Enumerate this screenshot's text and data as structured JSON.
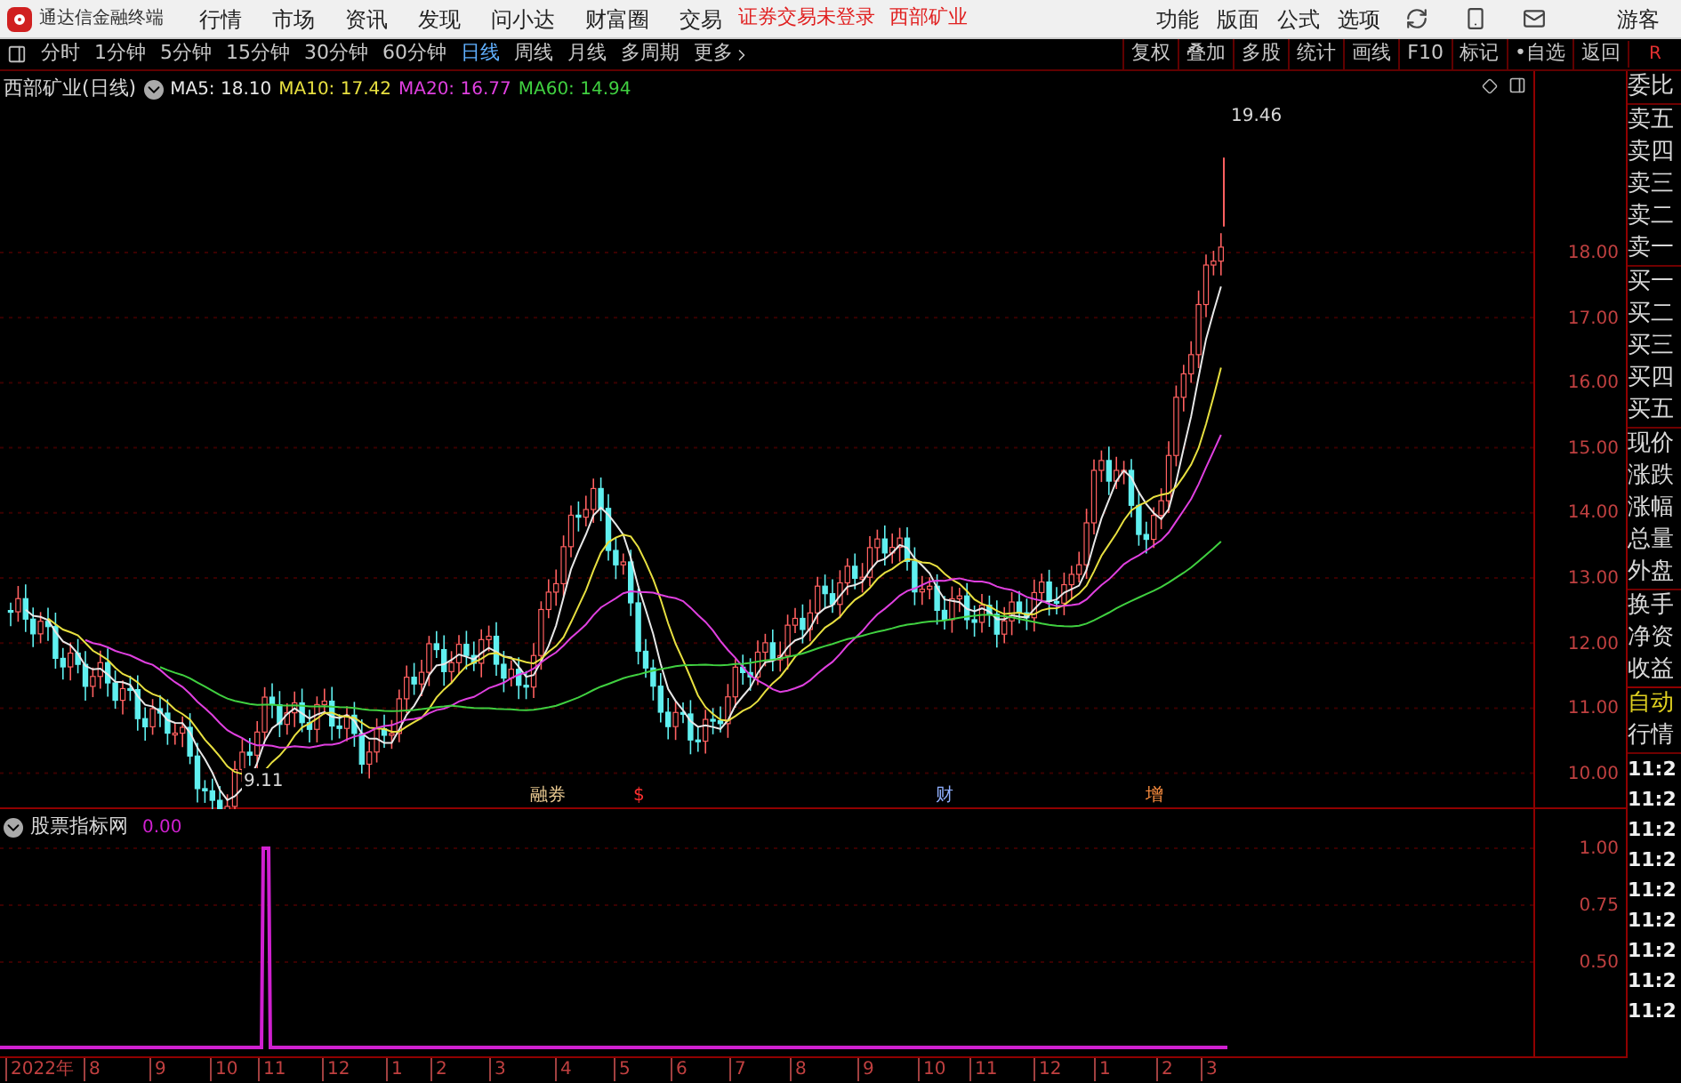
{
  "menubar": {
    "app_title": "通达信金融终端",
    "menus": [
      "行情",
      "市场",
      "资讯",
      "发现",
      "问小达",
      "财富圈",
      "交易"
    ],
    "status": "证券交易未登录",
    "stock": "西部矿业",
    "right_menus": [
      "功能",
      "版面",
      "公式",
      "选项"
    ],
    "user": "游客"
  },
  "toolbar": {
    "periods": [
      {
        "label": "分时",
        "selected": false
      },
      {
        "label": "1分钟",
        "selected": false
      },
      {
        "label": "5分钟",
        "selected": false
      },
      {
        "label": "15分钟",
        "selected": false
      },
      {
        "label": "30分钟",
        "selected": false
      },
      {
        "label": "60分钟",
        "selected": false
      },
      {
        "label": "日线",
        "selected": true
      },
      {
        "label": "周线",
        "selected": false
      },
      {
        "label": "月线",
        "selected": false
      },
      {
        "label": "多周期",
        "selected": false
      }
    ],
    "more": "更多",
    "actions": [
      "复权",
      "叠加",
      "多股",
      "统计",
      "画线",
      "F10",
      "标记",
      "•自选",
      "返回"
    ]
  },
  "chart": {
    "title": "西部矿业(日线)",
    "ma": [
      {
        "label": "MA5: 18.10",
        "color": "#e8e8e8"
      },
      {
        "label": "MA10: 17.42",
        "color": "#e8e040"
      },
      {
        "label": "MA20: 16.77",
        "color": "#e040e0"
      },
      {
        "label": "MA60: 14.94",
        "color": "#40d040"
      }
    ],
    "price_ticks": [
      "18.00",
      "17.00",
      "16.00",
      "15.00",
      "14.00",
      "13.00",
      "12.00",
      "11.00",
      "10.00"
    ],
    "high_label": "19.46",
    "low_label": "9.11",
    "event_markers": [
      {
        "label": "融券",
        "color": "#e8c890"
      },
      {
        "label": "$",
        "color": "#ff3030"
      },
      {
        "label": "财",
        "color": "#90b0ff"
      },
      {
        "label": "增",
        "color": "#ff9040"
      }
    ]
  },
  "indicator": {
    "title": "股票指标网",
    "value": "0.00",
    "ticks": [
      "1.00",
      "0.75",
      "0.50"
    ]
  },
  "x_axis": {
    "labels": [
      "2022年",
      "8",
      "9",
      "10",
      "11",
      "12",
      "1",
      "2",
      "3",
      "4",
      "5",
      "6",
      "7",
      "8",
      "9",
      "10",
      "11",
      "12",
      "1",
      "2",
      "3"
    ]
  },
  "side_panel": {
    "top": "R",
    "items": [
      "委比",
      "卖五",
      "卖四",
      "卖三",
      "卖二",
      "卖一",
      "买一",
      "买二",
      "买三",
      "买四",
      "买五",
      "现价",
      "涨跌",
      "涨幅",
      "总量",
      "外盘",
      "换手",
      "净资",
      "收益"
    ],
    "auto_label": "自动",
    "market_label": "行情",
    "times": [
      "11:2",
      "11:2",
      "11:2",
      "11:2",
      "11:2",
      "11:2",
      "11:2",
      "11:2",
      "11:2"
    ]
  }
}
